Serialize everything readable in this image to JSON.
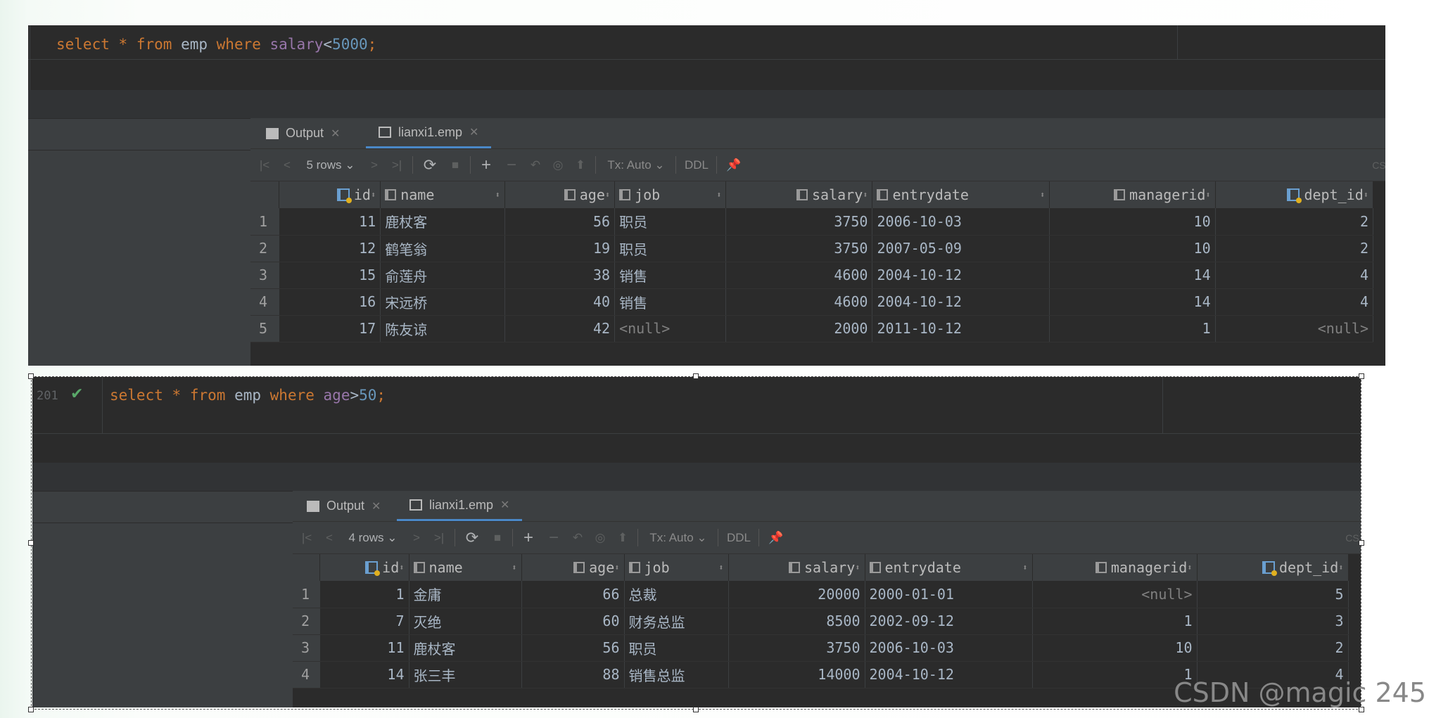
{
  "top": {
    "query": {
      "kw1": "select",
      "star": "*",
      "kw2": "from",
      "table": "emp",
      "kw3": "where",
      "column": "salary",
      "op": "<",
      "value": "5000",
      "end": ";"
    },
    "tabs": {
      "output": "Output",
      "result": "lianxi1.emp"
    },
    "toolbar": {
      "rows": "5 rows",
      "tx": "Tx: Auto",
      "ddl": "DDL",
      "extra": "CS"
    },
    "columns": [
      "id",
      "name",
      "age",
      "job",
      "salary",
      "entrydate",
      "managerid",
      "dept_id"
    ],
    "rows": [
      {
        "n": "1",
        "id": "11",
        "name": "鹿杖客",
        "age": "56",
        "job": "职员",
        "salary": "3750",
        "entrydate": "2006-10-03",
        "managerid": "10",
        "dept_id": "2"
      },
      {
        "n": "2",
        "id": "12",
        "name": "鹤笔翁",
        "age": "19",
        "job": "职员",
        "salary": "3750",
        "entrydate": "2007-05-09",
        "managerid": "10",
        "dept_id": "2"
      },
      {
        "n": "3",
        "id": "15",
        "name": "俞莲舟",
        "age": "38",
        "job": "销售",
        "salary": "4600",
        "entrydate": "2004-10-12",
        "managerid": "14",
        "dept_id": "4"
      },
      {
        "n": "4",
        "id": "16",
        "name": "宋远桥",
        "age": "40",
        "job": "销售",
        "salary": "4600",
        "entrydate": "2004-10-12",
        "managerid": "14",
        "dept_id": "4"
      },
      {
        "n": "5",
        "id": "17",
        "name": "陈友谅",
        "age": "42",
        "job": "<null>",
        "salary": "2000",
        "entrydate": "2011-10-12",
        "managerid": "1",
        "dept_id": "<null>"
      }
    ]
  },
  "bottom": {
    "line_number": "201",
    "query": {
      "kw1": "select",
      "star": "*",
      "kw2": "from",
      "table": "emp",
      "kw3": "where",
      "column": "age",
      "op": ">",
      "value": "50",
      "end": ";"
    },
    "tabs": {
      "output": "Output",
      "result": "lianxi1.emp"
    },
    "toolbar": {
      "rows": "4 rows",
      "tx": "Tx: Auto",
      "ddl": "DDL",
      "extra": "CS"
    },
    "columns": [
      "id",
      "name",
      "age",
      "job",
      "salary",
      "entrydate",
      "managerid",
      "dept_id"
    ],
    "rows": [
      {
        "n": "1",
        "id": "1",
        "name": "金庸",
        "age": "66",
        "job": "总裁",
        "salary": "20000",
        "entrydate": "2000-01-01",
        "managerid": "<null>",
        "dept_id": "5"
      },
      {
        "n": "2",
        "id": "7",
        "name": "灭绝",
        "age": "60",
        "job": "财务总监",
        "salary": "8500",
        "entrydate": "2002-09-12",
        "managerid": "1",
        "dept_id": "3"
      },
      {
        "n": "3",
        "id": "11",
        "name": "鹿杖客",
        "age": "56",
        "job": "职员",
        "salary": "3750",
        "entrydate": "2006-10-03",
        "managerid": "10",
        "dept_id": "2"
      },
      {
        "n": "4",
        "id": "14",
        "name": "张三丰",
        "age": "88",
        "job": "销售总监",
        "salary": "14000",
        "entrydate": "2004-10-12",
        "managerid": "1",
        "dept_id": "4"
      }
    ]
  },
  "watermark": "CSDN @magic 245",
  "colors": {
    "keyword": "#cc7832",
    "column": "#9876aa",
    "number": "#6897bb",
    "background": "#2b2b2b"
  }
}
